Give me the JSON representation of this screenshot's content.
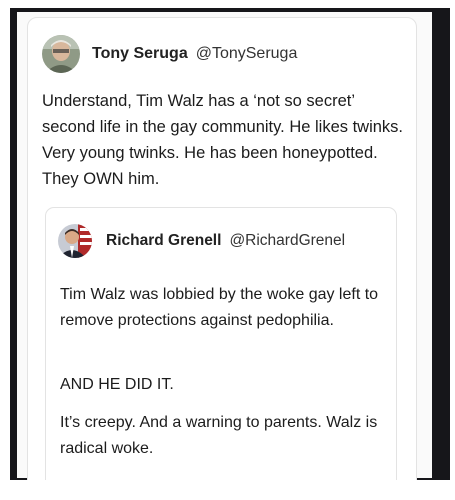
{
  "post": {
    "author_name": "Tony Seruga",
    "author_handle": "@TonySeruga",
    "avatar_icon": "profile-photo-icon",
    "text": "Understand, Tim Walz has a ‘not so secret’ second life in the gay community. He likes twinks. Very young twinks. He has been honeypotted. They OWN him."
  },
  "quoted_post": {
    "author_name": "Richard Grenell",
    "author_handle": "@RichardGrenel",
    "avatar_icon": "profile-photo-icon",
    "paragraphs": [
      "Tim Walz was lobbied by the woke gay left to remove protections against pedophilia.",
      "AND HE DID IT.",
      "It’s creepy. And a warning to parents. Walz is radical woke."
    ]
  },
  "colors": {
    "frame": "#16161a",
    "card_border": "#e3e3e3",
    "text": "#1c1c1c"
  }
}
